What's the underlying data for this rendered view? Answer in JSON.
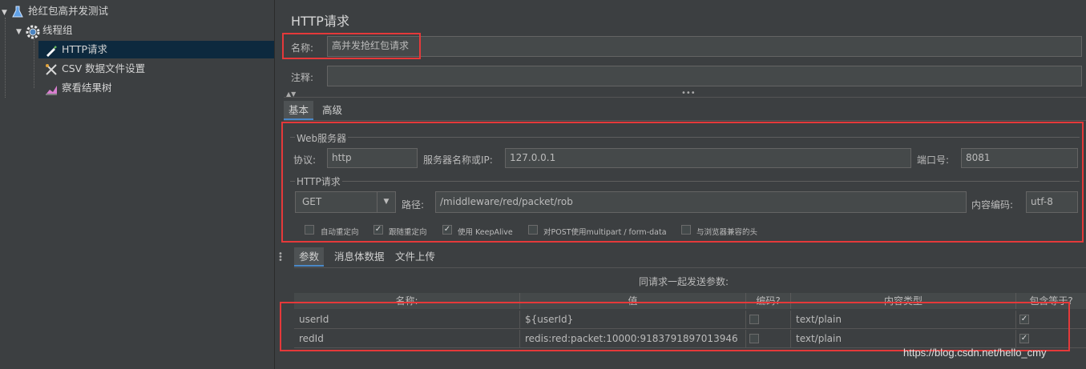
{
  "tree": {
    "items": [
      {
        "label": "抢红包高并发测试",
        "icon": "flask-icon"
      },
      {
        "label": "线程组",
        "icon": "gear-icon"
      },
      {
        "label": "HTTP请求",
        "icon": "pipette-icon"
      },
      {
        "label": "CSV 数据文件设置",
        "icon": "wrench-icon"
      },
      {
        "label": "察看结果树",
        "icon": "chart-icon"
      }
    ]
  },
  "panel": {
    "title": "HTTP请求",
    "name_label": "名称:",
    "name_value": "高并发抢红包请求",
    "comment_label": "注释:",
    "comment_value": "",
    "tabs": [
      "基本",
      "高级"
    ],
    "web_server": {
      "title": "Web服务器",
      "protocol_label": "协议:",
      "protocol_value": "http",
      "server_label": "服务器名称或IP:",
      "server_value": "127.0.0.1",
      "port_label": "端口号:",
      "port_value": "8081"
    },
    "http_request": {
      "title": "HTTP请求",
      "method": "GET",
      "path_label": "路径:",
      "path_value": "/middleware/red/packet/rob",
      "encoding_label": "内容编码:",
      "encoding_value": "utf-8"
    },
    "checkboxes": [
      {
        "label": "自动重定向",
        "checked": false
      },
      {
        "label": "跟随重定向",
        "checked": true
      },
      {
        "label": "使用 KeepAlive",
        "checked": true
      },
      {
        "label": "对POST使用multipart / form-data",
        "checked": false
      },
      {
        "label": "与浏览器兼容的头",
        "checked": false
      }
    ],
    "sub_tabs": [
      "参数",
      "消息体数据",
      "文件上传"
    ],
    "params_caption": "同请求一起发送参数:",
    "table": {
      "headers": [
        "名称:",
        "值",
        "编码?",
        "内容类型",
        "包含等于?"
      ],
      "rows": [
        {
          "name": "userId",
          "value": "${userId}",
          "encode": false,
          "content_type": "text/plain",
          "include_equals": true
        },
        {
          "name": "redId",
          "value": "redis:red:packet:10000:9183791897013946",
          "encode": false,
          "content_type": "text/plain",
          "include_equals": true
        }
      ]
    }
  },
  "watermark": "https://blog.csdn.net/hello_cmy",
  "colors": {
    "accent_red": "#e5393a",
    "selected_row": "#0d293e",
    "background": "#3c3f41"
  }
}
